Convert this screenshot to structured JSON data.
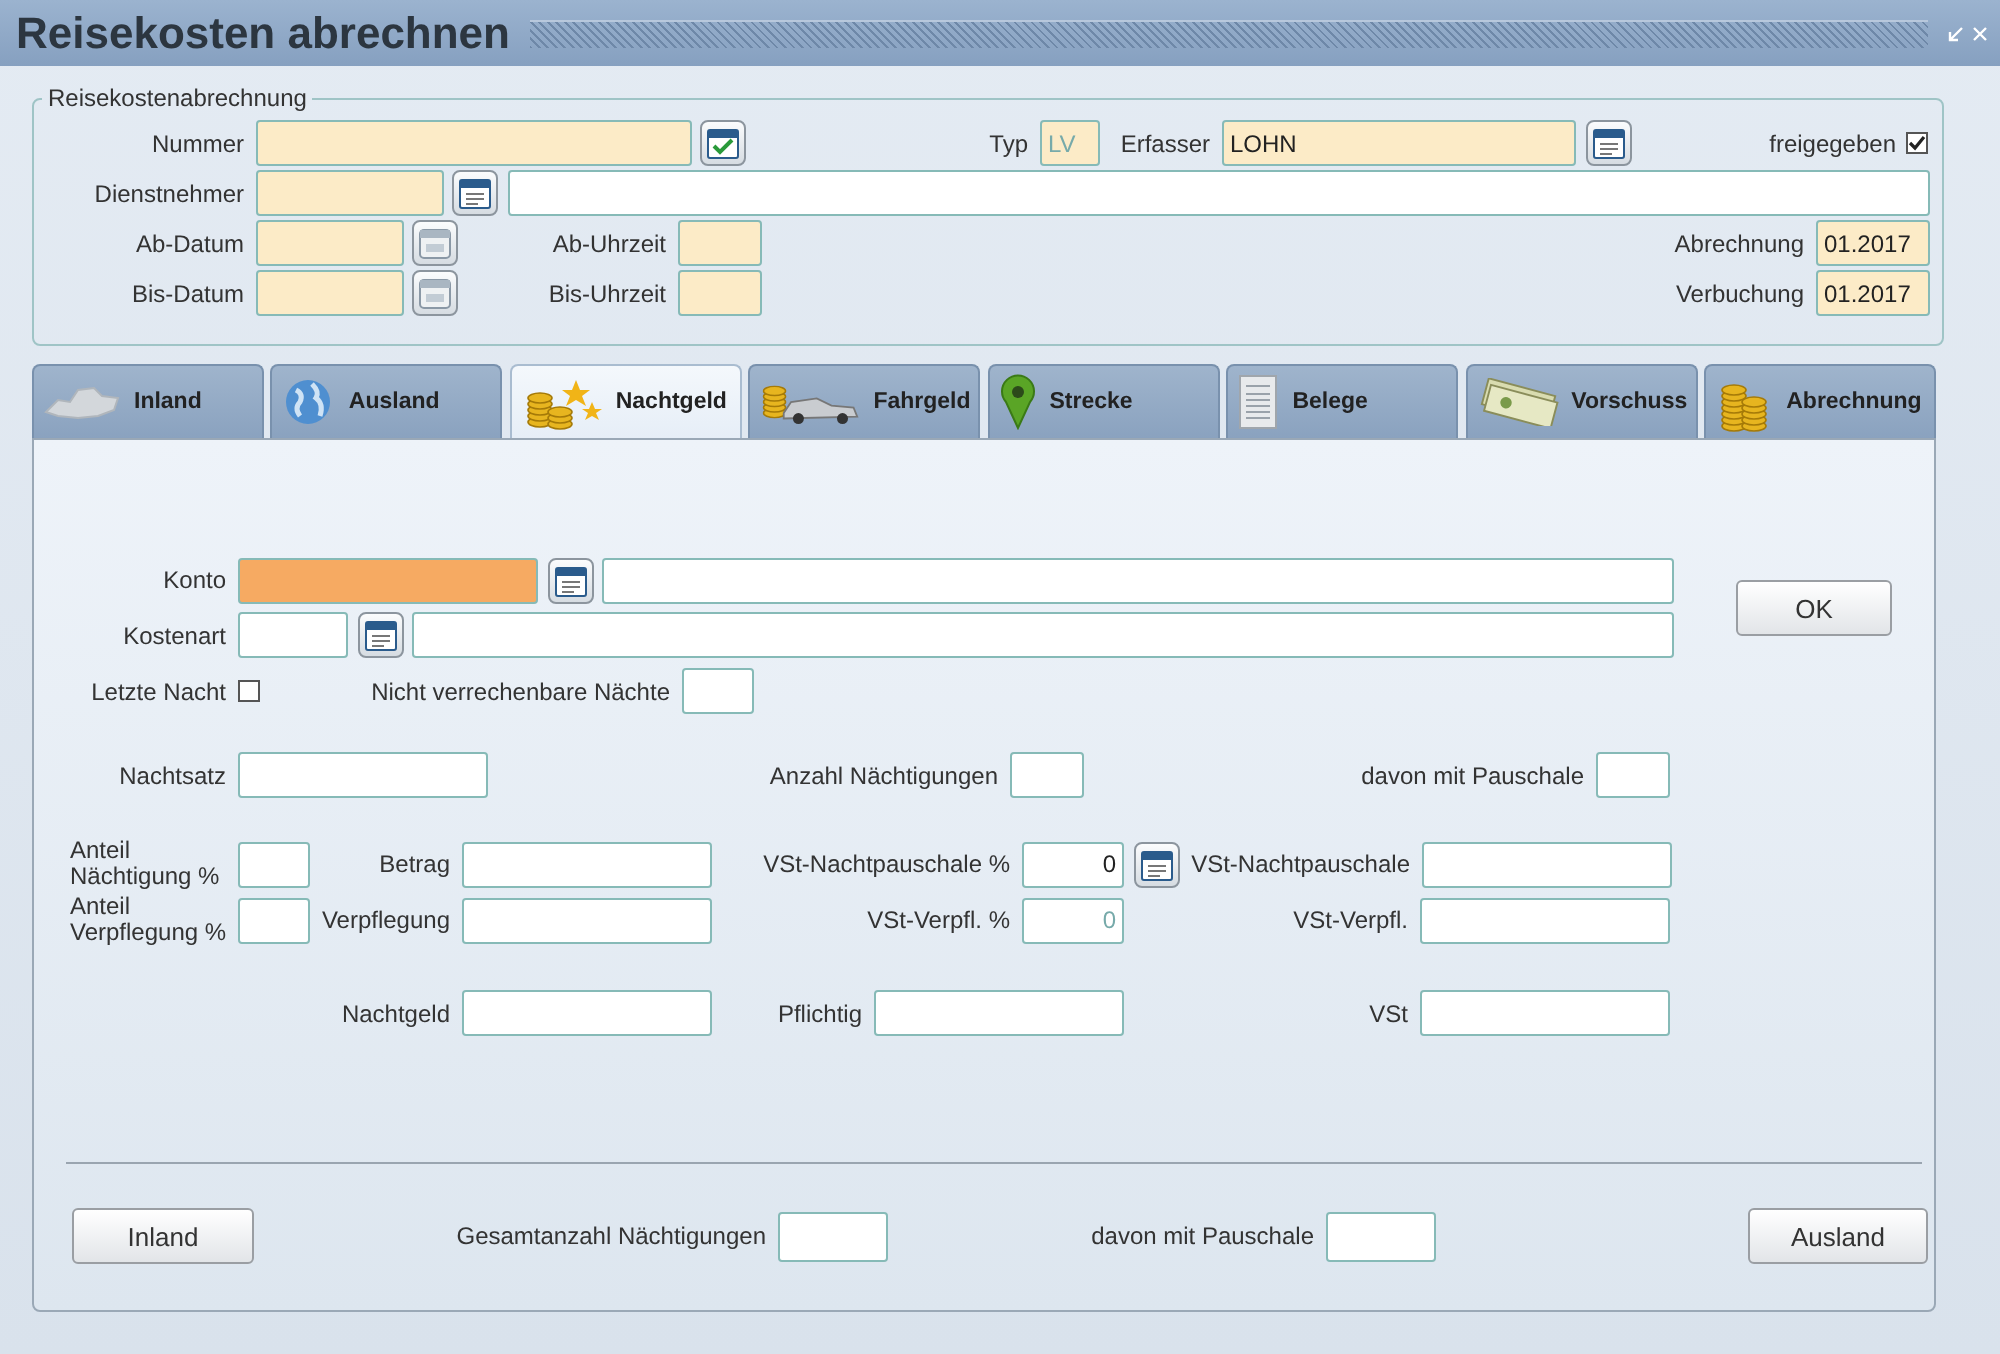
{
  "title": "Reisekosten abrechnen",
  "header": {
    "legend": "Reisekostenabrechnung",
    "nummer": {
      "label": "Nummer"
    },
    "typ": {
      "label": "Typ",
      "value": "LV"
    },
    "erfasser": {
      "label": "Erfasser",
      "value": "LOHN"
    },
    "freigegeben": {
      "label": "freigegeben",
      "checked": true
    },
    "dienstnehmer": {
      "label": "Dienstnehmer"
    },
    "ab_datum": {
      "label": "Ab-Datum"
    },
    "ab_uhrzeit": {
      "label": "Ab-Uhrzeit"
    },
    "abrechnung": {
      "label": "Abrechnung",
      "value": "01.2017"
    },
    "bis_datum": {
      "label": "Bis-Datum"
    },
    "bis_uhrzeit": {
      "label": "Bis-Uhrzeit"
    },
    "verbuchung": {
      "label": "Verbuchung",
      "value": "01.2017"
    }
  },
  "tabs": [
    {
      "label": "Inland",
      "kind": "map",
      "selected": false
    },
    {
      "label": "Ausland",
      "kind": "globe",
      "selected": false
    },
    {
      "label": "Nachtgeld",
      "kind": "coins_stars",
      "selected": true
    },
    {
      "label": "Fahrgeld",
      "kind": "coins_car",
      "selected": false
    },
    {
      "label": "Strecke",
      "kind": "pin",
      "selected": false
    },
    {
      "label": "Belege",
      "kind": "receipt",
      "selected": false
    },
    {
      "label": "Vorschuss",
      "kind": "banknotes",
      "selected": false
    },
    {
      "label": "Abrechnung",
      "kind": "coins",
      "selected": false
    }
  ],
  "form": {
    "konto": {
      "label": "Konto",
      "focused": true
    },
    "kostenart": {
      "label": "Kostenart"
    },
    "ok_button": "OK",
    "letzte_nacht": {
      "label": "Letzte Nacht",
      "checked": false
    },
    "nicht_verrechenbare": {
      "label": "Nicht verrechenbare Nächte"
    },
    "nachtsatz": {
      "label": "Nachtsatz"
    },
    "anzahl": {
      "label": "Anzahl Nächtigungen"
    },
    "davon": {
      "label": "davon mit Pauschale"
    },
    "anteil_naechtigung": {
      "label": "Anteil Nächtigung %"
    },
    "betrag": {
      "label": "Betrag"
    },
    "vst_nacht_pct": {
      "label": "VSt-Nachtpauschale %",
      "value": "0",
      "disabled": false
    },
    "vst_nachtpauschale": {
      "label": "VSt-Nachtpauschale"
    },
    "anteil_verpflegung": {
      "label": "Anteil Verpflegung %"
    },
    "verpflegung": {
      "label": "Verpflegung"
    },
    "vst_verpfl_pct": {
      "label": "VSt-Verpfl. %",
      "value": "0",
      "disabled": true
    },
    "vst_verpfl": {
      "label": "VSt-Verpfl."
    },
    "nachtgeld": {
      "label": "Nachtgeld"
    },
    "pflichtig": {
      "label": "Pflichtig"
    },
    "vst": {
      "label": "VSt"
    }
  },
  "footer": {
    "inland_button": "Inland",
    "gesamtanzahl": {
      "label": "Gesamtanzahl Nächtigungen"
    },
    "davon": {
      "label": "davon mit Pauschale"
    },
    "ausland_button": "Ausland"
  }
}
